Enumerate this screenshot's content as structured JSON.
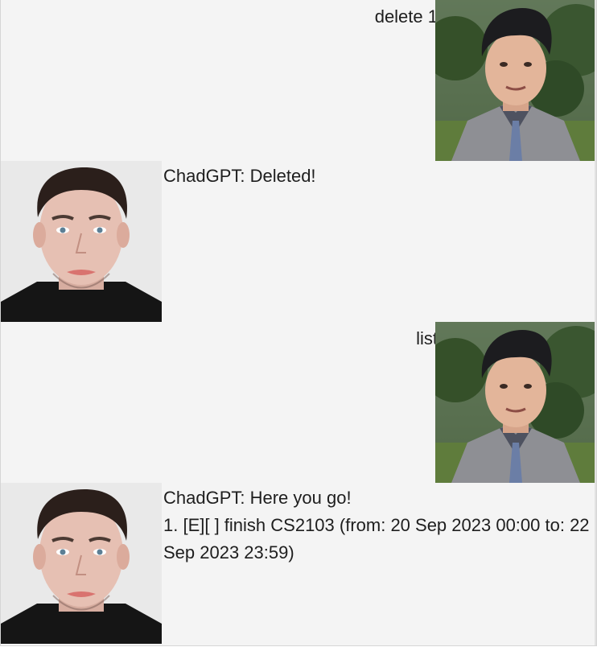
{
  "conversation": {
    "messages": [
      {
        "sender": "user",
        "text": "delete 1",
        "avatar": "user-avatar"
      },
      {
        "sender": "bot",
        "text": "ChadGPT: Deleted!",
        "avatar": "chadgpt-avatar"
      },
      {
        "sender": "user",
        "text": "list",
        "avatar": "user-avatar"
      },
      {
        "sender": "bot",
        "text": "ChadGPT: Here you go!\n1. [E][ ] finish CS2103 (from: 20 Sep 2023 00:00 to: 22 Sep 2023 23:59)",
        "avatar": "chadgpt-avatar"
      }
    ]
  },
  "colors": {
    "background": "#f4f4f4",
    "text": "#1e1e1e"
  }
}
